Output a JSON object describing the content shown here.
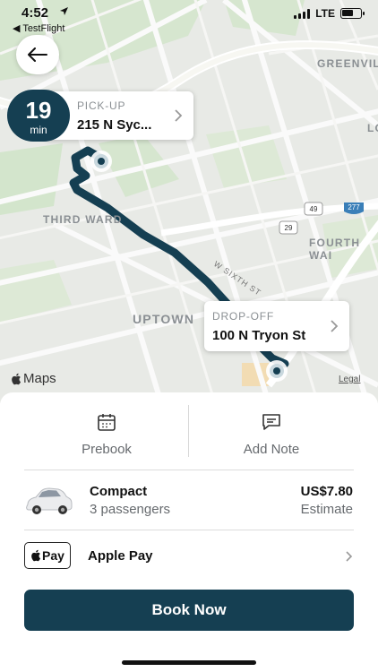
{
  "status_bar": {
    "time": "4:52",
    "back_app": "◀ TestFlight",
    "network": "LTE",
    "battery_level": 0.65
  },
  "colors": {
    "brand": "#153f52",
    "route": "#153f52",
    "map_bg": "#e8eae6",
    "park": "#cfe3c7"
  },
  "map": {
    "labels": {
      "greenville": "GREENVILL",
      "lo": "LO",
      "third_ward": "THIRD WARD",
      "fourth_ward": "FOURTH WAI",
      "uptown": "UPTOWN",
      "w_sixth": "W SIXTH ST"
    },
    "shields": {
      "i277": "277",
      "us29": "29",
      "nc49": "49"
    },
    "provider": "Maps",
    "legal": "Legal"
  },
  "eta": {
    "minutes": "19",
    "unit": "min"
  },
  "pickup": {
    "caption": "PICK-UP",
    "address": "215 N Syc..."
  },
  "dropoff": {
    "caption": "DROP-OFF",
    "address": "100 N Tryon St"
  },
  "actions": {
    "prebook_label": "Prebook",
    "add_note_label": "Add Note"
  },
  "ride": {
    "name": "Compact",
    "passengers": "3 passengers",
    "price": "US$7.80",
    "price_note": "Estimate"
  },
  "payment": {
    "badge": "Pay",
    "name": "Apple Pay"
  },
  "book_button": "Book Now"
}
